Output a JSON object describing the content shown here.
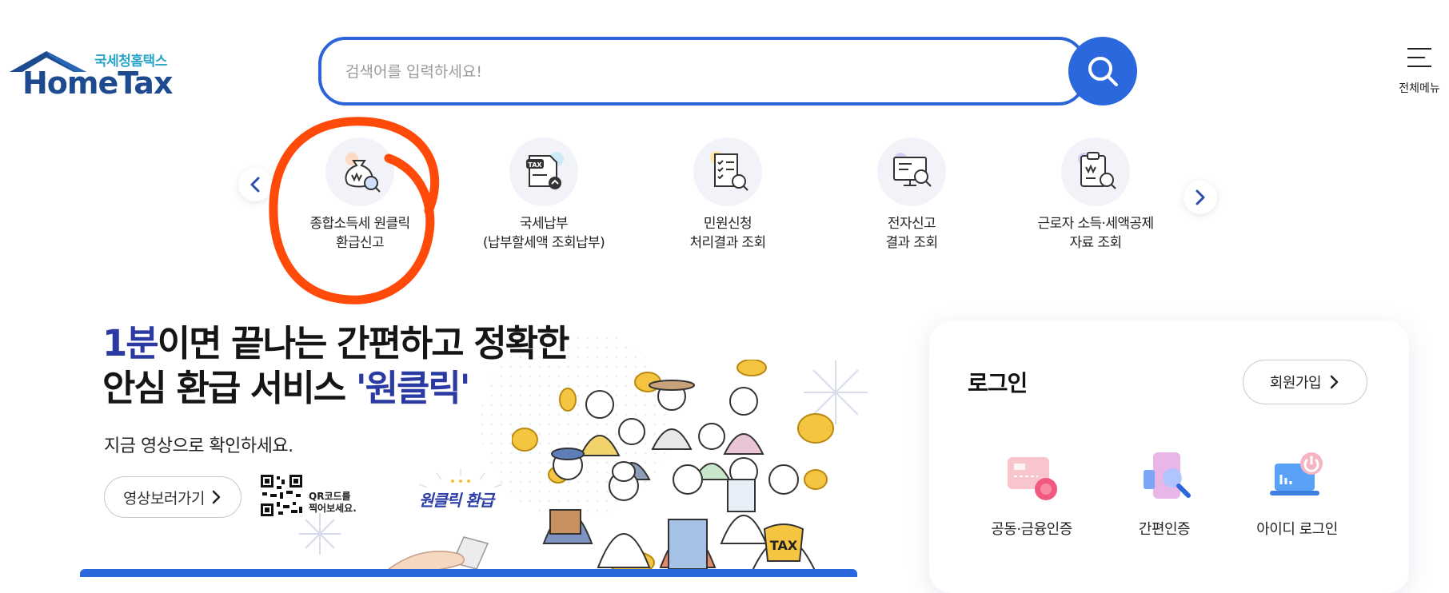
{
  "header": {
    "logo_subtitle": "국세청홈택스",
    "logo_title": "HomeTax",
    "search_placeholder": "검색어를 입력하세요!",
    "all_menu_label": "전체메뉴"
  },
  "quick_menu": {
    "items": [
      {
        "line1": "종합소득세 원클릭",
        "line2": "환급신고",
        "icon": "money-bag-search-icon"
      },
      {
        "line1": "국세납부",
        "line2": "(납부할세액 조회납부)",
        "icon": "tax-document-upload-icon"
      },
      {
        "line1": "민원신청",
        "line2": "처리결과 조회",
        "icon": "checklist-search-icon"
      },
      {
        "line1": "전자신고",
        "line2": "결과 조회",
        "icon": "monitor-search-icon"
      },
      {
        "line1": "근로자 소득·세액공제",
        "line2": "자료 조회",
        "icon": "clipboard-search-icon"
      }
    ]
  },
  "banner": {
    "headline_highlight": "1분",
    "headline_line1_rest": "이면 끝나는 간편하고 정확한",
    "headline_line2_prefix": "안심 환급 서비스 ",
    "headline_line2_highlight": "'원클릭'",
    "subtext": "지금 영상으로 확인하세요.",
    "video_button_label": "영상보러가기",
    "qr_note_line1": "QR코드를",
    "qr_note_line2": "찍어보세요.",
    "oneclick_label": "원클릭 환급",
    "tax_bag_text": "TAX"
  },
  "login": {
    "title": "로그인",
    "signup_label": "회원가입",
    "options": [
      {
        "label": "공동·금융인증",
        "icon": "certificate-icon"
      },
      {
        "label": "간편인증",
        "icon": "simple-auth-icon"
      },
      {
        "label": "아이디 로그인",
        "icon": "id-login-icon"
      }
    ]
  },
  "colors": {
    "brand_blue": "#2b67dd",
    "headline_blue": "#2b3aa3",
    "annotation_red": "#ff4a0a"
  }
}
